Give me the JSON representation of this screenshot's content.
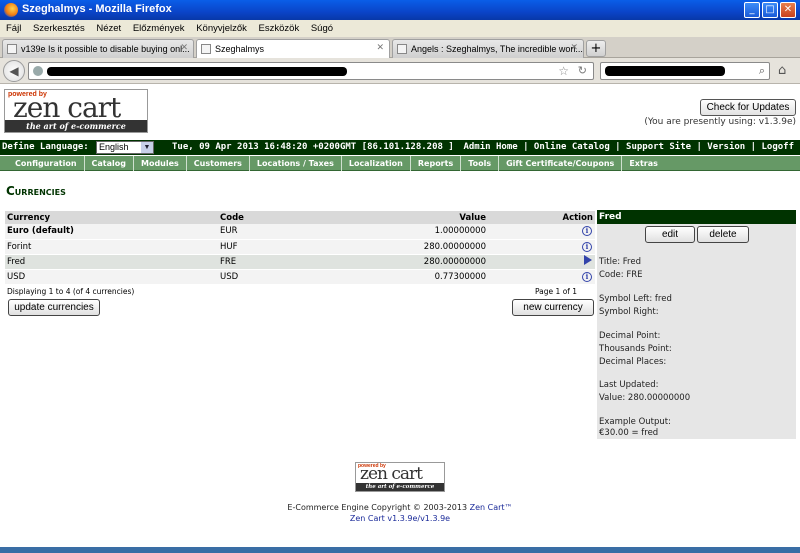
{
  "window": {
    "title": "Szeghalmys - Mozilla Firefox"
  },
  "menubar": [
    "Fájl",
    "Szerkesztés",
    "Nézet",
    "Előzmények",
    "Könyvjelzők",
    "Eszközök",
    "Súgó"
  ],
  "tabs": [
    {
      "label": "v139e Is it possible to disable buying onl..."
    },
    {
      "label": "Szeghalmys"
    },
    {
      "label": "Angels : Szeghalmys, The incredible worl..."
    }
  ],
  "header": {
    "logo": {
      "powered": "powered by",
      "wordmark": "zen cart",
      "tagline": "the art of e-commerce"
    },
    "check_updates": "Check for Updates",
    "version_using": "(You are presently using: v1.3.9e)",
    "define_language": "Define Language:",
    "language": "English",
    "datetime": "Tue, 09 Apr 2013 16:48:20 +0200GMT [86.101.128.208 ]",
    "toplinks": "Admin Home | Online Catalog | Support Site | Version | Logoff"
  },
  "nav": [
    "Configuration",
    "Catalog",
    "Modules",
    "Customers",
    "Locations / Taxes",
    "Localization",
    "Reports",
    "Tools",
    "Gift Certificate/Coupons",
    "Extras"
  ],
  "page": {
    "title": "Currencies"
  },
  "table": {
    "headers": {
      "currency": "Currency",
      "code": "Code",
      "value": "Value",
      "action": "Action"
    },
    "rows": [
      {
        "currency": "Euro (default)",
        "code": "EUR",
        "value": "1.00000000",
        "action": "info"
      },
      {
        "currency": "Forint",
        "code": "HUF",
        "value": "280.00000000",
        "action": "info"
      },
      {
        "currency": "Fred",
        "code": "FRE",
        "value": "280.00000000",
        "action": "selected"
      },
      {
        "currency": "USD",
        "code": "USD",
        "value": "0.77300000",
        "action": "info"
      }
    ],
    "displaying": "Displaying 1 to 4 (of 4 currencies)",
    "page_of": "Page 1 of 1",
    "update_button": "update currencies",
    "new_button": "new currency"
  },
  "infobox": {
    "heading": "Fred",
    "edit": "edit",
    "delete": "delete",
    "title_line": "Title: Fred",
    "code_line": "Code: FRE",
    "symbol_left": "Symbol Left: fred",
    "symbol_right": "Symbol Right:",
    "decimal_point": "Decimal Point:",
    "thousands_point": "Thousands Point:",
    "decimal_places": "Decimal Places:",
    "last_updated": "Last Updated:",
    "value_line": "Value: 280.00000000",
    "example_output": "Example Output:",
    "example_value": "€30.00 = fred"
  },
  "footer": {
    "logo": {
      "powered": "powered by",
      "wordmark": "zen cart",
      "tagline": "the art of e-commerce"
    },
    "copyright_prefix": "E-Commerce Engine Copyright © 2003-2013 ",
    "copyright_link": "Zen Cart™",
    "version_link": "Zen Cart v1.3.9e/v1.3.9e"
  }
}
